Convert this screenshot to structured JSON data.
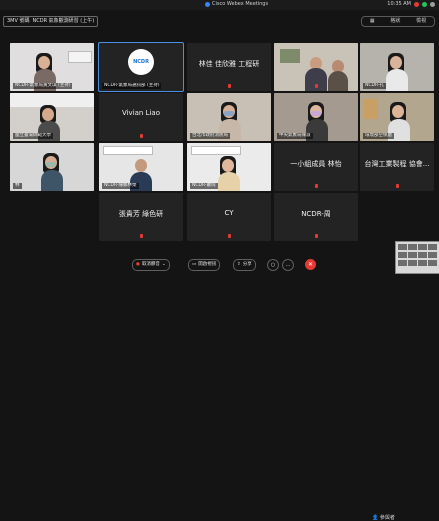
{
  "window": {
    "title": "Cisco Webex Meetings",
    "status_text": "10:35 AM"
  },
  "meeting": {
    "label_left": "3MV 號碼",
    "label_main": "NCDR 氣象觀測研習 (上午)",
    "view_label": "格狀",
    "view_option": "檢視"
  },
  "participants": [
    {
      "name": "NCDR-氣象局黃文琪 (主持)",
      "kind": "video",
      "mic_muted": true
    },
    {
      "name": "NCDR-氣象局通訊部 (主持)",
      "kind": "logo",
      "logo_text": "NCDR",
      "mic_muted": false
    },
    {
      "name": "林佳 佳欣雅 工程研",
      "kind": "text",
      "mic_muted": true
    },
    {
      "name": "",
      "kind": "video",
      "mic_muted": true
    },
    {
      "name": "NCDR-孔",
      "kind": "video",
      "mic_muted": true
    },
    {
      "name": "國立臺灣師範大學",
      "kind": "video",
      "mic_muted": true
    },
    {
      "name": "Vivian Liao",
      "kind": "text",
      "mic_muted": true
    },
    {
      "name": "台北市政府消防局",
      "kind": "video",
      "mic_muted": true
    },
    {
      "name": "中央氣象局陳淑",
      "kind": "video",
      "mic_muted": true
    },
    {
      "name": "環境部空保處",
      "kind": "video",
      "mic_muted": true
    },
    {
      "name": "林",
      "kind": "video",
      "mic_muted": true
    },
    {
      "name": "NCDR-陳鄭林榮",
      "kind": "video",
      "mic_muted": true
    },
    {
      "name": "NCDR-蕭琬",
      "kind": "video",
      "mic_muted": true
    },
    {
      "name": "一小組成員 林怡",
      "kind": "text",
      "mic_muted": true
    },
    {
      "name": "台灣工業製程 協會...",
      "kind": "text",
      "mic_muted": true
    },
    {
      "name": "張貴芳 綠色研",
      "kind": "text",
      "mic_muted": true
    },
    {
      "name": "CY",
      "kind": "text",
      "mic_muted": true
    },
    {
      "name": "NCDR-周",
      "kind": "text",
      "mic_muted": true
    }
  ],
  "toolbar": {
    "mute_label": "取消靜音",
    "video_label": "開啟視訊",
    "share_label": "分享",
    "more_label": "...",
    "end_label": "✕",
    "participants_label": "參與者"
  },
  "colors": {
    "background": "#141414",
    "tile": "#232323",
    "accent": "#4a90e2",
    "danger": "#e53935"
  }
}
